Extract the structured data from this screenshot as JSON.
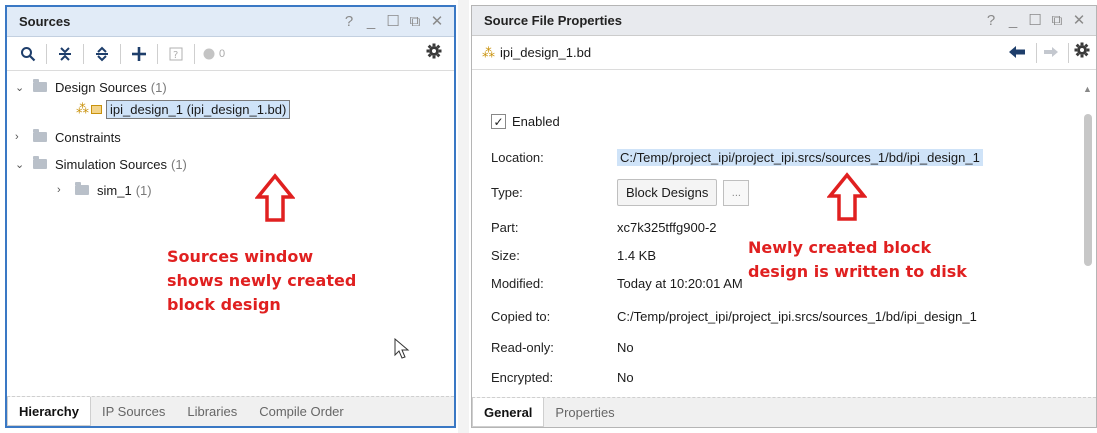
{
  "sources_panel": {
    "title": "Sources",
    "window_controls": [
      "?",
      "_",
      "☐",
      "⧉",
      "✕"
    ],
    "toolbar": {
      "pending_count": "0"
    },
    "tree": {
      "design_sources": {
        "label": "Design Sources",
        "count": "(1)"
      },
      "design_file": {
        "label": "ipi_design_1 (ipi_design_1.bd)"
      },
      "constraints": {
        "label": "Constraints"
      },
      "simulation_sources": {
        "label": "Simulation Sources",
        "count": "(1)"
      },
      "sim_1": {
        "label": "sim_1",
        "count": "(1)"
      }
    },
    "annotation": [
      "Sources window",
      "shows newly created",
      "block design"
    ],
    "bottom_tabs": [
      "Hierarchy",
      "IP Sources",
      "Libraries",
      "Compile Order"
    ],
    "active_tab": "Hierarchy"
  },
  "properties_panel": {
    "title": "Source File Properties",
    "window_controls": [
      "?",
      "_",
      "☐",
      "⧉",
      "✕"
    ],
    "file_name": "ipi_design_1.bd",
    "enabled_label": "Enabled",
    "enabled_checked": true,
    "rows": {
      "location": {
        "label": "Location:",
        "value": "C:/Temp/project_ipi/project_ipi.srcs/sources_1/bd/ipi_design_1"
      },
      "type": {
        "label": "Type:",
        "value": "Block Designs",
        "more": "..."
      },
      "part": {
        "label": "Part:",
        "value": "xc7k325tffg900-2"
      },
      "size": {
        "label": "Size:",
        "value": "1.4 KB"
      },
      "modified": {
        "label": "Modified:",
        "value": "Today at 10:20:01 AM"
      },
      "copied_to": {
        "label": "Copied to:",
        "value": "C:/Temp/project_ipi/project_ipi.srcs/sources_1/bd/ipi_design_1"
      },
      "read_only": {
        "label": "Read-only:",
        "value": "No"
      },
      "encrypted": {
        "label": "Encrypted:",
        "value": "No"
      }
    },
    "annotation": [
      "Newly created block",
      "design is written to disk"
    ],
    "bottom_tabs": [
      "General",
      "Properties"
    ],
    "active_tab": "General"
  },
  "colors": {
    "annotation_red": "#e02020",
    "selection_blue": "#cfe3f8",
    "active_border_blue": "#3a78c4",
    "icon_navy": "#1e3e6b",
    "bd_icon_gold": "#c9920c"
  }
}
